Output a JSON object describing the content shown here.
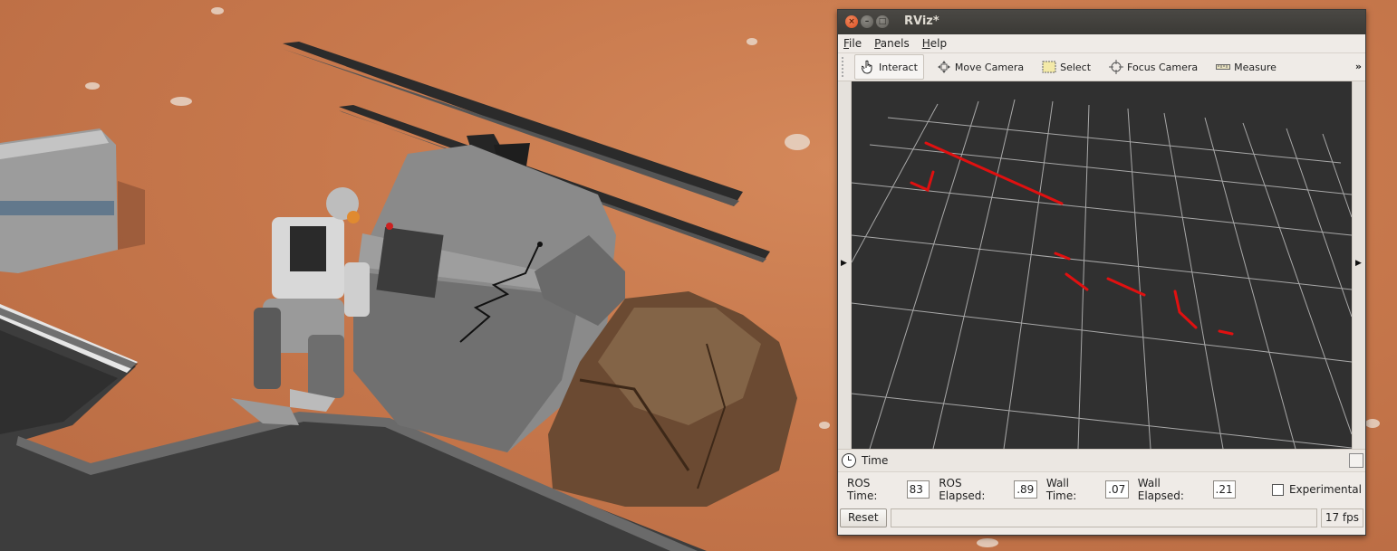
{
  "window": {
    "title": "RViz*"
  },
  "menu": {
    "items": [
      "File",
      "Panels",
      "Help"
    ]
  },
  "toolbar": {
    "tools": [
      {
        "label": "Interact",
        "icon": "hand-pointer-icon",
        "active": true
      },
      {
        "label": "Move Camera",
        "icon": "move-camera-icon",
        "active": false
      },
      {
        "label": "Select",
        "icon": "select-box-icon",
        "active": false
      },
      {
        "label": "Focus Camera",
        "icon": "focus-crosshair-icon",
        "active": false
      },
      {
        "label": "Measure",
        "icon": "ruler-icon",
        "active": false
      }
    ],
    "overflow": "»"
  },
  "viewport": {
    "background": "#303030",
    "grid_color": "#a8a8a8",
    "scan_color": "#e01010"
  },
  "time_panel": {
    "title": "Time",
    "ros_time_label": "ROS Time:",
    "ros_time_value": "83",
    "ros_elapsed_label": "ROS Elapsed:",
    "ros_elapsed_value": ".89",
    "wall_time_label": "Wall Time:",
    "wall_time_value": ".07",
    "wall_elapsed_label": "Wall Elapsed:",
    "wall_elapsed_value": ".21",
    "experimental_label": "Experimental",
    "experimental_checked": false
  },
  "status": {
    "reset_label": "Reset",
    "fps": "17 fps"
  },
  "colors": {
    "terrain": "#c7784c",
    "titlebar": "#3b3a36",
    "panel": "#efebe7"
  }
}
